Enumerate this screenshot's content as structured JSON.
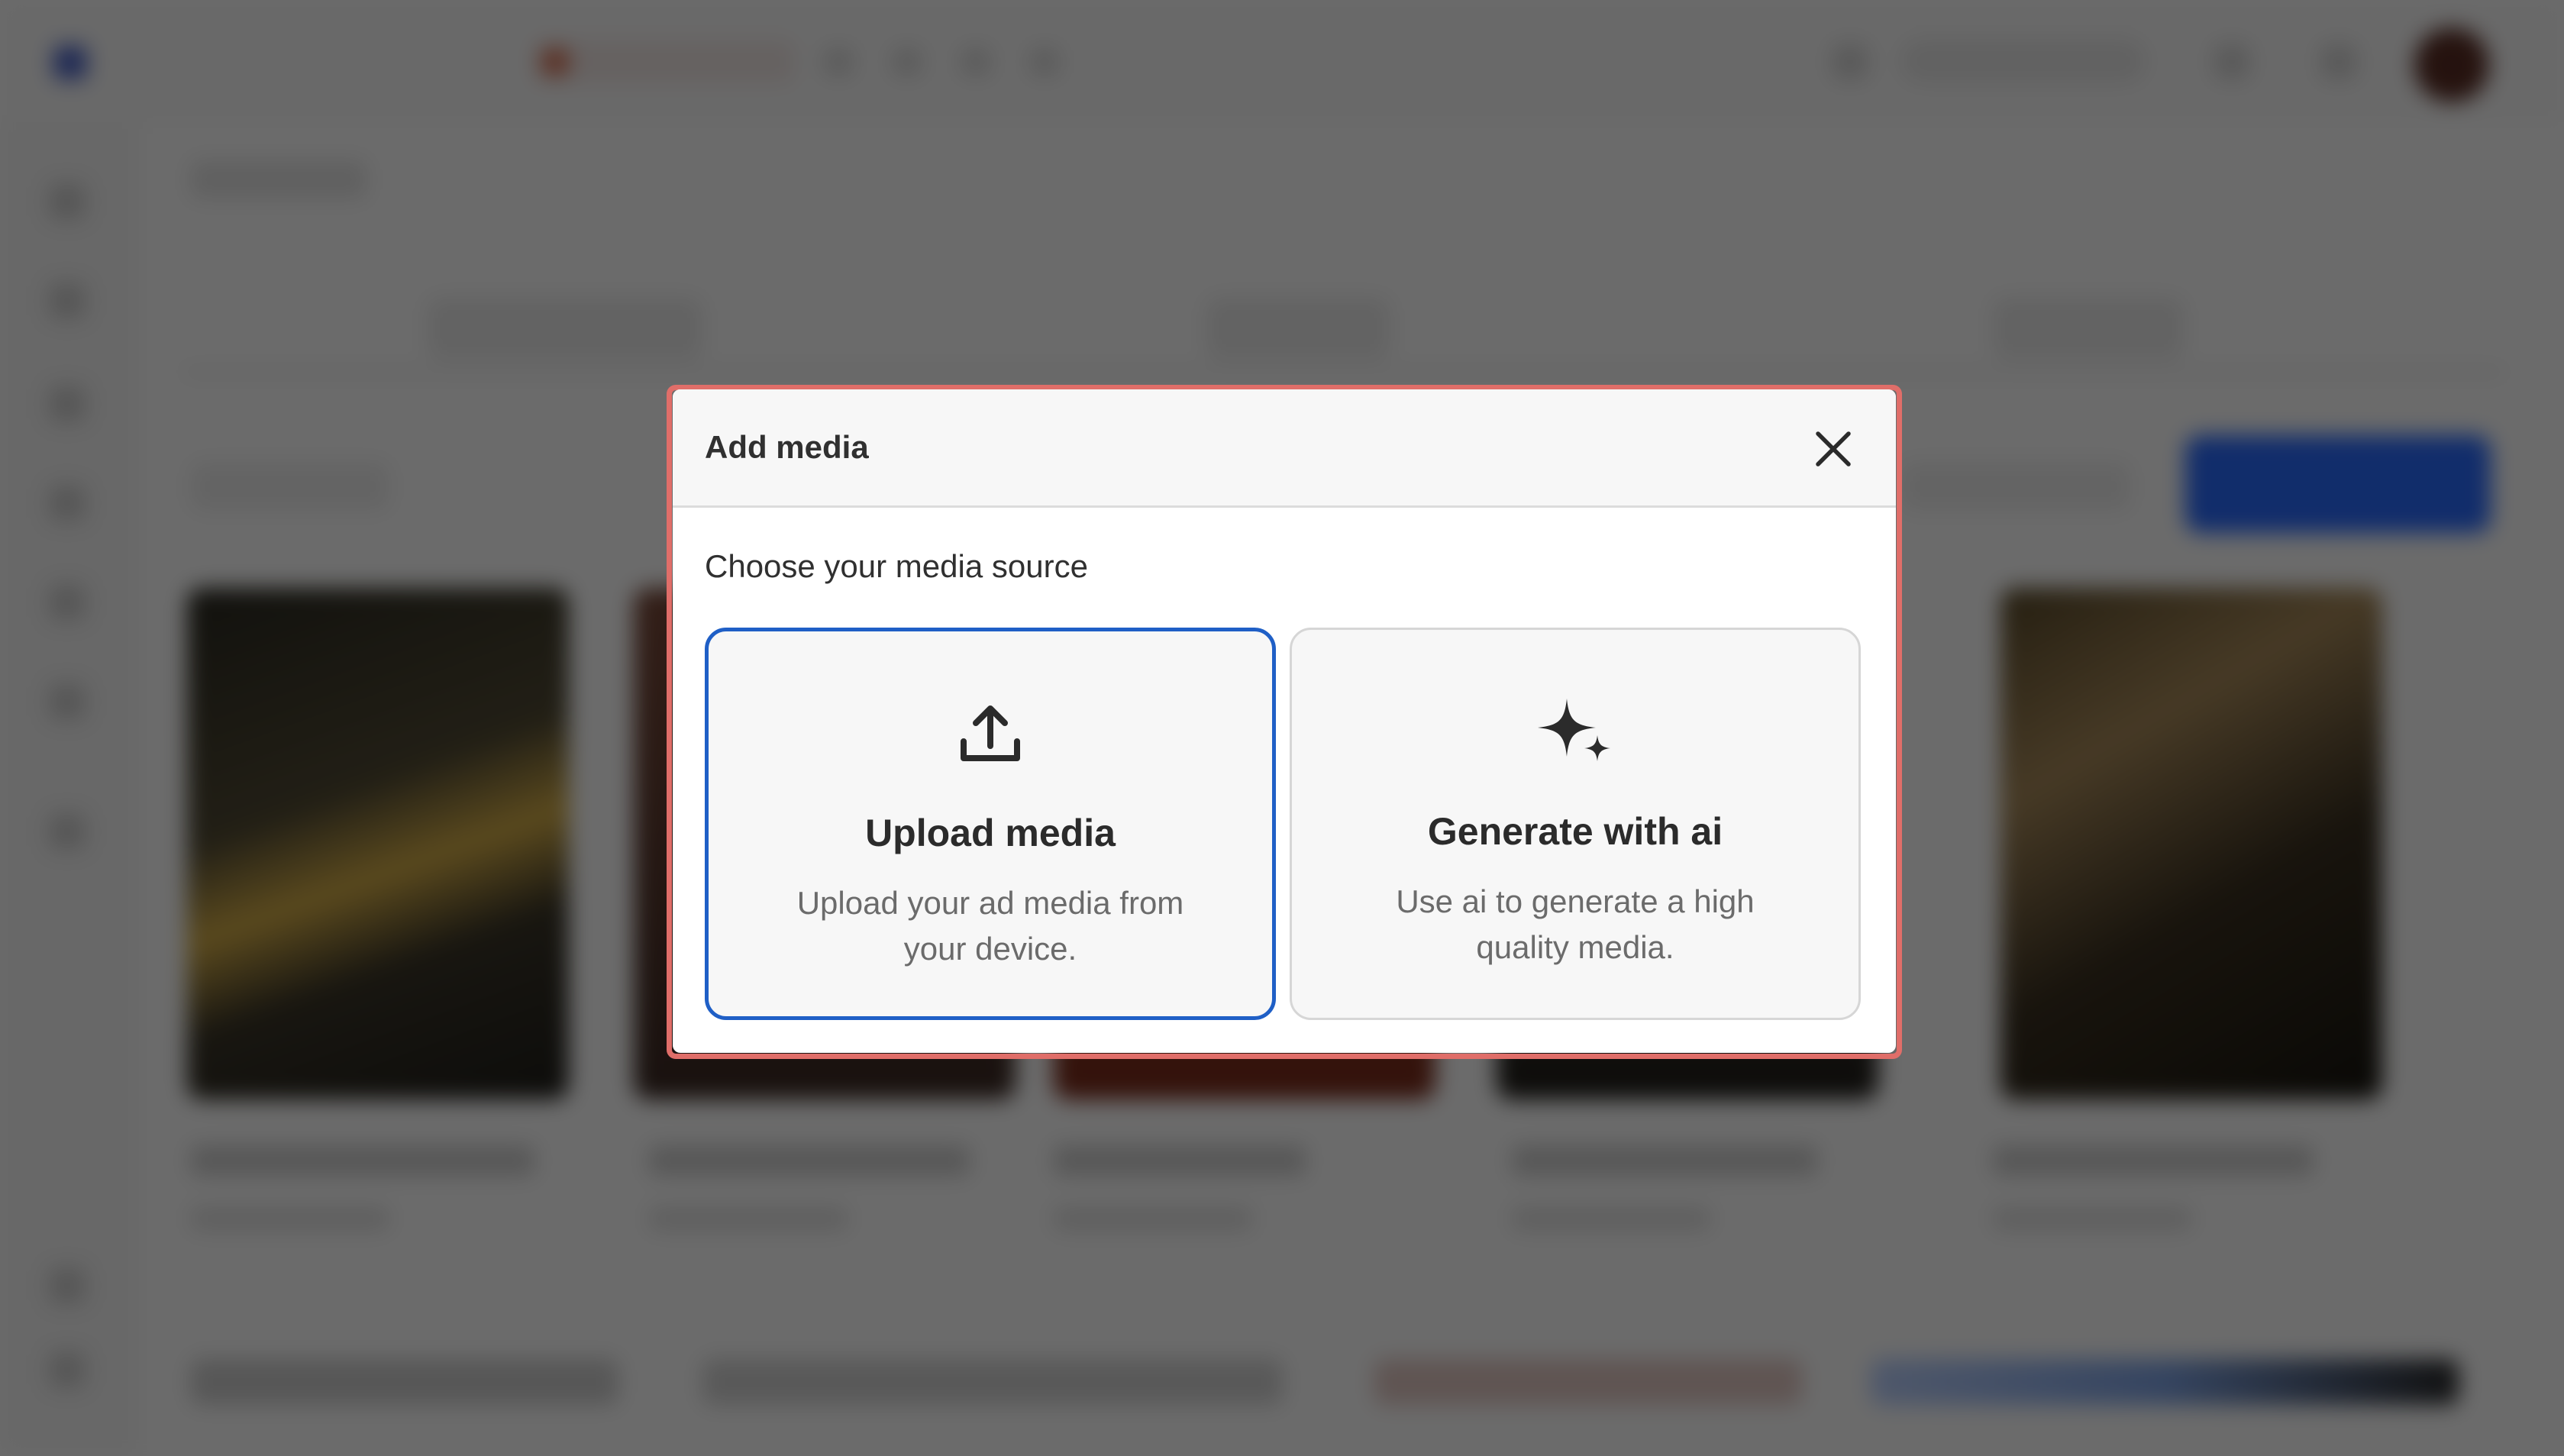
{
  "modal": {
    "title": "Add media",
    "subtitle": "Choose your media source",
    "close_icon": "close-icon",
    "options": [
      {
        "title": "Upload media",
        "description": "Upload your ad media from your device.",
        "icon": "upload-icon",
        "selected": true
      },
      {
        "title": "Generate with ai",
        "description": "Use ai to generate a high quality media.",
        "icon": "sparkles-icon",
        "selected": false
      }
    ]
  },
  "colors": {
    "modal_outline": "#e06e69",
    "selected_border": "#1f5fc6",
    "primary_button": "#2a6bff"
  }
}
